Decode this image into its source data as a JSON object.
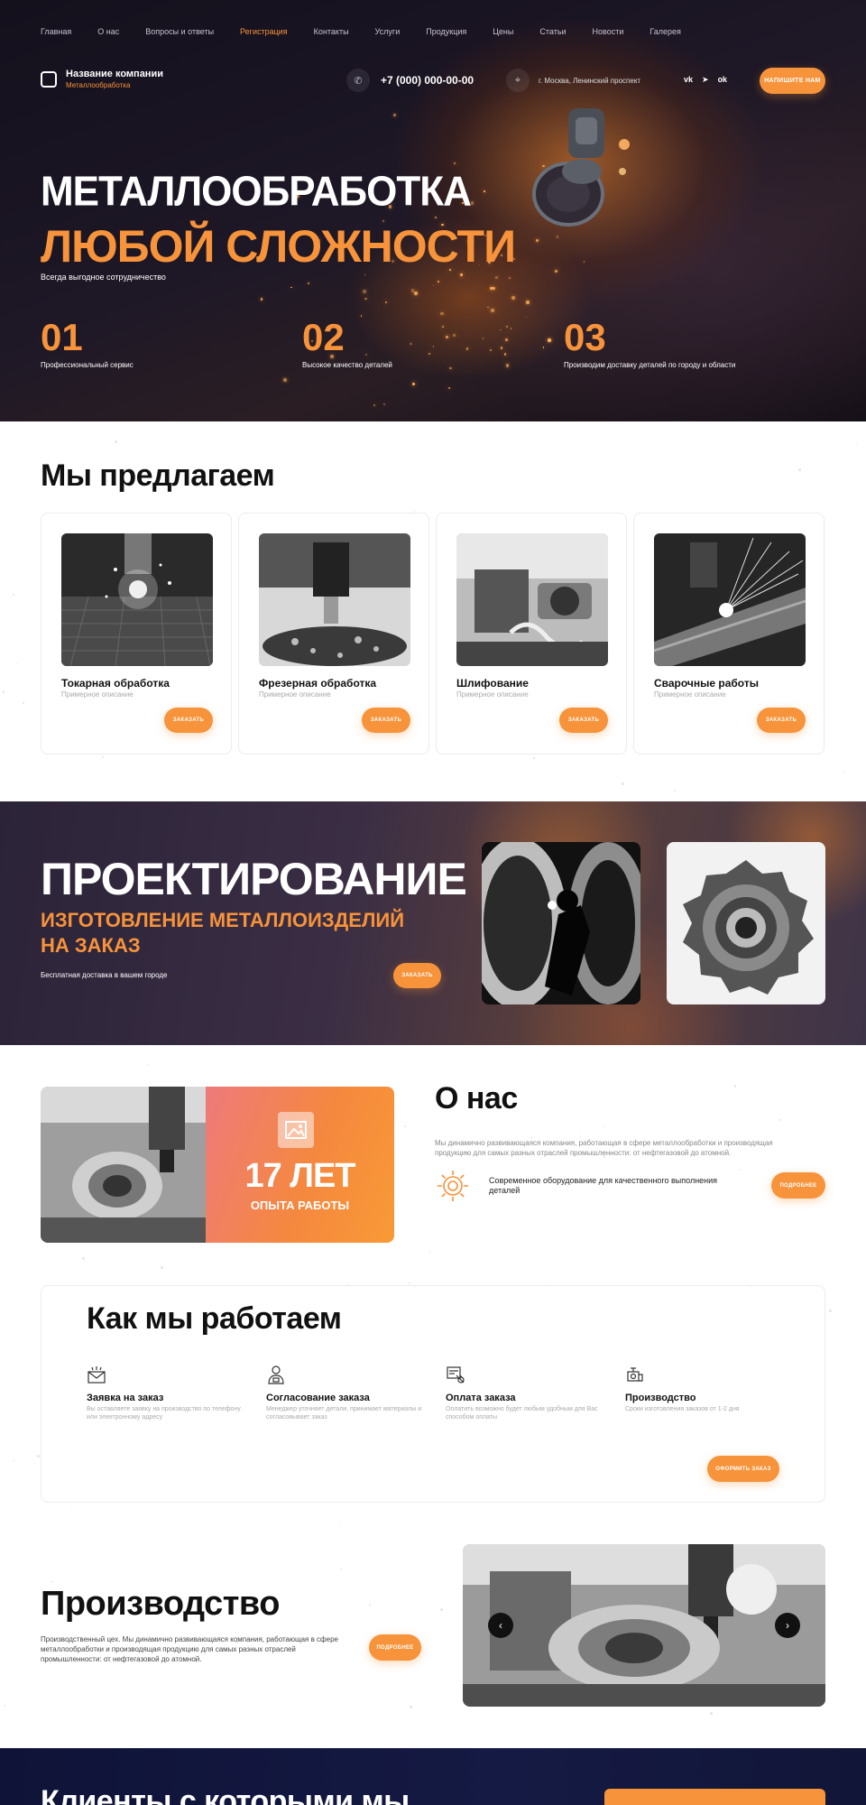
{
  "nav": {
    "items": [
      {
        "label": "Главная",
        "active": false
      },
      {
        "label": "О нас",
        "active": false
      },
      {
        "label": "Вопросы и ответы",
        "active": false
      },
      {
        "label": "Регистрация",
        "active": true
      },
      {
        "label": "Контакты",
        "active": false
      },
      {
        "label": "Услуги",
        "active": false
      },
      {
        "label": "Продукция",
        "active": false
      },
      {
        "label": "Цены",
        "active": false
      },
      {
        "label": "Статьи",
        "active": false
      },
      {
        "label": "Новости",
        "active": false
      },
      {
        "label": "Галерея",
        "active": false
      }
    ]
  },
  "header": {
    "company_name": "Название компании",
    "company_sub": "Металлообработка",
    "phone": "+7 (000) 000-00-00",
    "address": "г. Москва, Ленинский проспект",
    "socials": [
      "vk",
      "tg",
      "ok"
    ],
    "cta_label": "Напишите нам"
  },
  "hero": {
    "title_line1": "МЕТАЛЛООБРАБОТКА",
    "title_line2": "ЛЮБОЙ СЛОЖНОСТИ",
    "tagline": "Всегда выгодное сотрудничество",
    "stats": [
      {
        "num": "01",
        "text": "Профессиональный сервис"
      },
      {
        "num": "02",
        "text": "Высокое качество деталей"
      },
      {
        "num": "03",
        "text": "Производим доставку деталей по городу и области"
      }
    ]
  },
  "offer": {
    "title": "Мы предлагаем",
    "cards": [
      {
        "title": "Токарная обработка",
        "desc": "Примерное описание",
        "button": "Заказать"
      },
      {
        "title": "Фрезерная обработка",
        "desc": "Примерное описание",
        "button": "Заказать"
      },
      {
        "title": "Шлифование",
        "desc": "Примерное описание",
        "button": "Заказать"
      },
      {
        "title": "Сварочные работы",
        "desc": "Примерное описание",
        "button": "Заказать"
      }
    ]
  },
  "banner": {
    "title": "ПРОЕКТИРОВАНИЕ",
    "subtitle": "ИЗГОТОВЛЕНИЕ МЕТАЛЛОИЗДЕЛИЙ НА ЗАКАЗ",
    "tagline": "Бесплатная доставка в вашем городе",
    "button": "Заказать"
  },
  "about": {
    "years": "17 ЛЕТ",
    "years_sub": "ОПЫТА РАБОТЫ",
    "title": "О нас",
    "text": "Мы динамично развивающаяся компания, работающая в сфере металлообработки и производящая продукцию для самых разных отраслей промышленности: от нефтегазовой до атомной.",
    "feature": "Современное оборудование для качественного выполнения деталей",
    "button": "Подробнее"
  },
  "work": {
    "title": "Как мы работаем",
    "steps": [
      {
        "title": "Заявка на заказ",
        "desc": "Вы оставляете заявку на производство по телефону или электронному адресу",
        "icon": "mail-icon"
      },
      {
        "title": "Согласование заказа",
        "desc": "Менеджер уточняет детали, принимает материалы и согласовывает заказ",
        "icon": "manager-icon"
      },
      {
        "title": "Оплата заказа",
        "desc": "Оплатить возможно будет любым удобным для Вас способом оплаты",
        "icon": "payment-icon"
      },
      {
        "title": "Производство",
        "desc": "Сроки изготовления заказов от 1-2 дня",
        "icon": "production-icon"
      }
    ],
    "button": "Оформить заказ"
  },
  "production": {
    "title": "Производство",
    "text": "Производственный цех. Мы динамично развивающаяся компания, работающая в сфере металлообработки и производящая продукцию для самых разных отраслей промышленности: от нефтегазовой до атомной.",
    "button": "Подробнее"
  },
  "clients": {
    "title": "Клиенты с которыми мы"
  },
  "colors": {
    "accent": "#f7933a",
    "hero_bg": "#1a1422",
    "clients_bg": "#12163f"
  }
}
